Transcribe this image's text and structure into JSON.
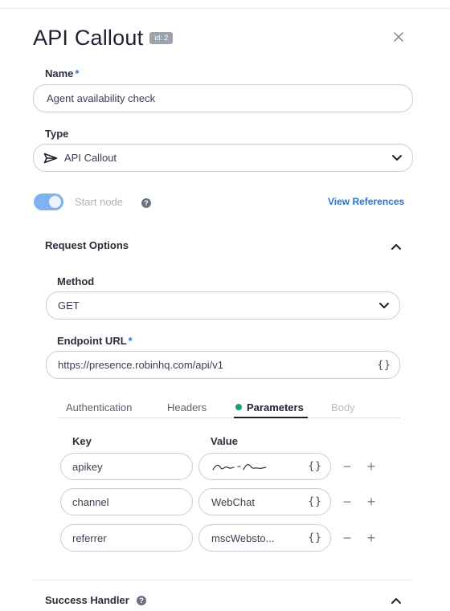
{
  "panel": {
    "title": "API Callout",
    "id_badge": "id: 2"
  },
  "name_field": {
    "label": "Name",
    "required_mark": "*",
    "value": "Agent availability check"
  },
  "type_field": {
    "label": "Type",
    "value": "API Callout",
    "icon": "paper-plane-icon"
  },
  "start_node": {
    "label": "Start node",
    "enabled": true,
    "help": "?"
  },
  "view_references": "View References",
  "request_options": {
    "title": "Request Options",
    "method": {
      "label": "Method",
      "value": "GET"
    },
    "endpoint": {
      "label": "Endpoint URL",
      "required_mark": "*",
      "value": "https://presence.robinhq.com/api/v1",
      "braces": "{}"
    },
    "tabs": [
      {
        "label": "Authentication"
      },
      {
        "label": "Headers"
      },
      {
        "label": "Parameters",
        "active": true
      },
      {
        "label": "Body",
        "disabled": true
      }
    ],
    "columns": {
      "key": "Key",
      "value": "Value"
    },
    "params": [
      {
        "key": "apikey",
        "value": "",
        "value_masked": true,
        "braces": "{}",
        "minus": "−",
        "plus": "+"
      },
      {
        "key": "channel",
        "value": "WebChat",
        "braces": "{}",
        "minus": "−",
        "plus": "+"
      },
      {
        "key": "referrer",
        "value": "mscWebsto...",
        "braces": "{}",
        "minus": "−",
        "plus": "+"
      }
    ]
  },
  "success_handler": {
    "title": "Success Handler",
    "help": "?"
  },
  "colors": {
    "accent": "#1f74d8",
    "toggle": "#7fb3f0",
    "active_dot": "#1e9e6a",
    "badge": "#9aa2ad"
  }
}
